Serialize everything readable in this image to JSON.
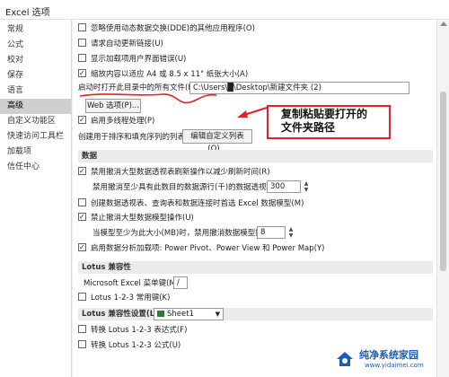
{
  "window": {
    "title": "Excel 选项"
  },
  "sidebar": {
    "items": [
      {
        "label": "常规",
        "active": false
      },
      {
        "label": "公式",
        "active": false
      },
      {
        "label": "校对",
        "active": false
      },
      {
        "label": "保存",
        "active": false
      },
      {
        "label": "语言",
        "active": false
      },
      {
        "label": "高级",
        "active": true
      },
      {
        "label": "自定义功能区",
        "active": false
      },
      {
        "label": "快速访问工具栏",
        "active": false
      },
      {
        "label": "加载项",
        "active": false
      },
      {
        "label": "信任中心",
        "active": false
      }
    ]
  },
  "general": {
    "opt_dde": "忽略使用动态数据交换(DDE)的其他应用程序(O)",
    "opt_auto_links": "请求自动更新链接(U)",
    "opt_addin_errors": "显示加载项用户界面错误(U)",
    "opt_scale_a4": "缩放内容以适应 A4 或 8.5 x 11\" 纸张大小(A)",
    "startup_label": "启动时打开此目录中的所有文件(L):",
    "startup_value": "C:\\Users\\█\\Desktop\\新建文件夹 (2)",
    "web_options_button": "Web 选项(P)...",
    "opt_multithread": "启用多线程处理(P)",
    "sort_lists_label": "创建用于排序和填充序列的列表:",
    "edit_custom_lists_button": "编辑自定义列表(O)..."
  },
  "data": {
    "section_title": "数据",
    "opt_disable_undo_pivot": "禁用撤消大型数据透视表刷新操作以减少刷新时间(R)",
    "undo_pivot_rows_label": "禁用撤消至少具有此数目的数据源行(千)的数据透视表(N):",
    "undo_pivot_rows_value": "300",
    "opt_prefer_excel_model": "创建数据透视表、查询表和数据连接时首选 Excel 数据模型(M)",
    "opt_disable_undo_model": "禁止撤消大型数据模型操作(U)",
    "undo_model_size_label": "当模型至少为此大小(MB)时，禁用撤消数据模型操作(L):",
    "undo_model_size_value": "8",
    "opt_data_addins": "启用数据分析加载项: Power Pivot、Power View 和 Power Map(Y)"
  },
  "lotus": {
    "section_title": "Lotus 兼容性",
    "menu_key_label": "Microsoft Excel 菜单键(M):",
    "menu_key_value": "/",
    "opt_lotus_keys": "Lotus 1-2-3 常用键(K)"
  },
  "lotus_settings": {
    "section_label": "Lotus 兼容性设置(L):",
    "sheet_value": "Sheet1",
    "opt_transition_eval": "转换 Lotus 1-2-3 表达式(F)",
    "opt_transition_formula": "转换 Lotus 1-2-3 公式(U)"
  },
  "annotation": {
    "text": "复制粘贴要打开的文件夹路径",
    "color": "#e0202a"
  },
  "watermark": {
    "text": "纯净系统家园",
    "url": "www.yidaimei.com"
  }
}
